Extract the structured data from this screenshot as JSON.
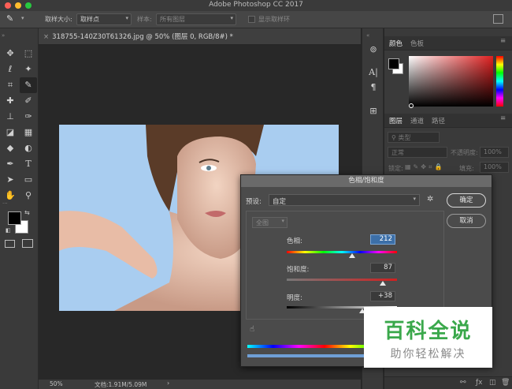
{
  "app": {
    "title": "Adobe Photoshop CC 2017"
  },
  "options_bar": {
    "sample_size_label": "取样大小:",
    "sample_size_value": "取样点",
    "sample_label": "样本:",
    "sample_value": "所有图层",
    "show_ring_label": "显示取样环"
  },
  "document": {
    "tab_title": "318755-140Z30T61326.jpg @ 50% (图层 0, RGB/8#) *",
    "zoom": "50%",
    "doc_size": "文档:1.91M/5.09M"
  },
  "panels": {
    "color_tab": "颜色",
    "swatches_tab": "色板",
    "layers_tab": "图层",
    "channels_tab": "通道",
    "paths_tab": "路径",
    "kind_label": "类型",
    "blend_mode": "正常",
    "opacity_label": "不透明度:",
    "opacity_value": "100%",
    "lock_label": "锁定:",
    "fill_label": "填充:",
    "fill_value": "100%"
  },
  "dialog": {
    "title": "色相/饱和度",
    "preset_label": "预设:",
    "preset_value": "自定",
    "channel_value": "全图",
    "hue_label": "色相:",
    "hue_value": "212",
    "saturation_label": "饱和度:",
    "saturation_value": "87",
    "lightness_label": "明度:",
    "lightness_value": "+38",
    "ok_label": "确定",
    "cancel_label": "取消"
  },
  "watermark": {
    "brand": "百科全说",
    "tagline": "助你轻松解决"
  },
  "colors": {
    "accent_selection": "#3c6fa8",
    "photo_background": "#a9cdf0"
  }
}
